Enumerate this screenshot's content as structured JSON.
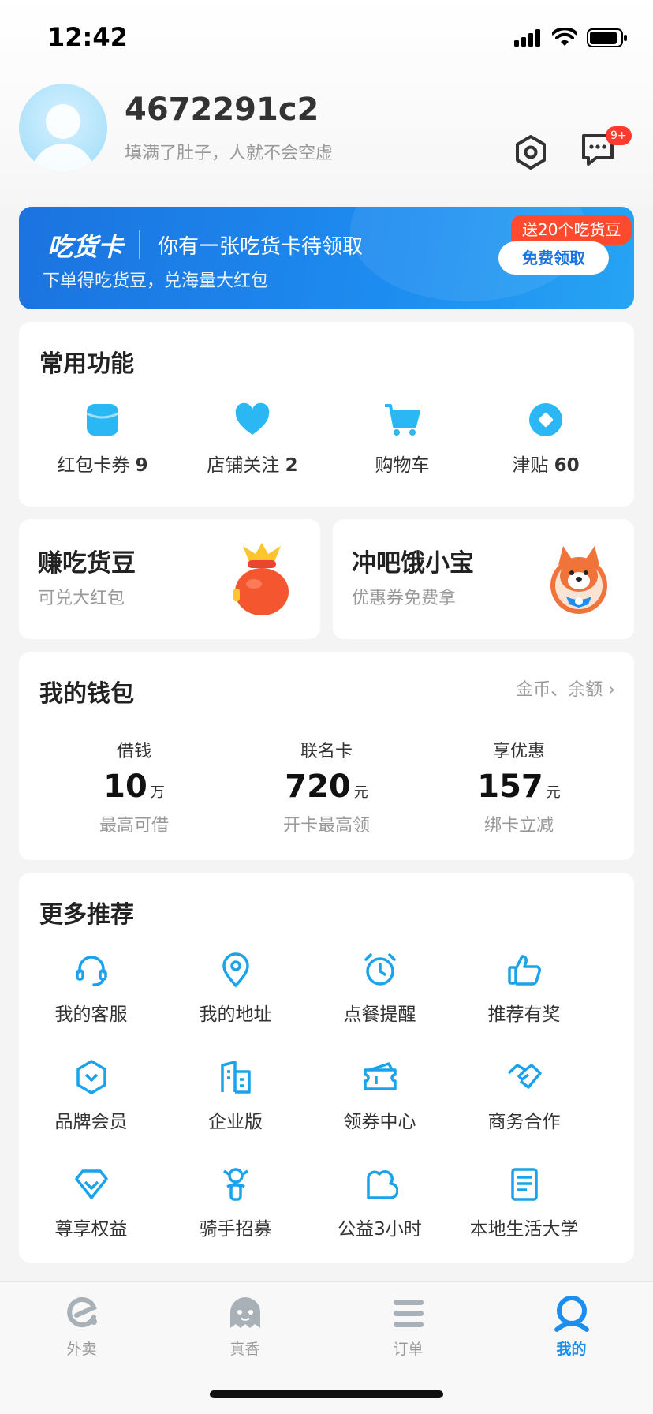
{
  "status_bar": {
    "time": "12:42"
  },
  "profile": {
    "username": "4672291c2",
    "motto": "填满了肚子，人就不会空虚",
    "message_badge": "9+"
  },
  "banner": {
    "logo": "吃货卡",
    "title": "你有一张吃货卡待领取",
    "subtitle": "下单得吃货豆，兑海量大红包",
    "tag": "送20个吃货豆",
    "button": "免费领取"
  },
  "common_features": {
    "title": "常用功能",
    "items": [
      {
        "label": "红包卡券",
        "count": "9",
        "icon": "coupon-icon"
      },
      {
        "label": "店铺关注",
        "count": "2",
        "icon": "heart-icon"
      },
      {
        "label": "购物车",
        "count": "",
        "icon": "cart-icon"
      },
      {
        "label": "津贴",
        "count": "60",
        "icon": "allowance-icon"
      }
    ]
  },
  "promos": [
    {
      "title": "赚吃货豆",
      "subtitle": "可兑大红包",
      "icon": "red-bag-icon"
    },
    {
      "title": "冲吧饿小宝",
      "subtitle": "优惠券免费拿",
      "icon": "shiba-mascot-icon"
    }
  ],
  "wallet": {
    "title": "我的钱包",
    "link": "金币、余额",
    "items": [
      {
        "header": "借钱",
        "value": "10",
        "unit": "万",
        "footer": "最高可借"
      },
      {
        "header": "联名卡",
        "value": "720",
        "unit": "元",
        "footer": "开卡最高领"
      },
      {
        "header": "享优惠",
        "value": "157",
        "unit": "元",
        "footer": "绑卡立减"
      }
    ]
  },
  "more": {
    "title": "更多推荐",
    "items": [
      {
        "label": "我的客服",
        "icon": "headset-icon"
      },
      {
        "label": "我的地址",
        "icon": "location-pin-icon"
      },
      {
        "label": "点餐提醒",
        "icon": "alarm-clock-icon"
      },
      {
        "label": "推荐有奖",
        "icon": "thumbs-up-icon"
      },
      {
        "label": "品牌会员",
        "icon": "brand-badge-icon"
      },
      {
        "label": "企业版",
        "icon": "building-icon"
      },
      {
        "label": "领券中心",
        "icon": "ticket-icon"
      },
      {
        "label": "商务合作",
        "icon": "handshake-icon"
      },
      {
        "label": "尊享权益",
        "icon": "diamond-icon"
      },
      {
        "label": "骑手招募",
        "icon": "rider-icon"
      },
      {
        "label": "公益3小时",
        "icon": "charity-icon"
      },
      {
        "label": "本地生活大学",
        "icon": "book-icon"
      }
    ]
  },
  "tabbar": {
    "items": [
      {
        "label": "外卖",
        "icon": "takeout-icon",
        "active": false
      },
      {
        "label": "真香",
        "icon": "ghost-icon",
        "active": false
      },
      {
        "label": "订单",
        "icon": "order-list-icon",
        "active": false
      },
      {
        "label": "我的",
        "icon": "profile-icon",
        "active": true
      }
    ]
  },
  "colors": {
    "accent": "#1a8ff0",
    "icon_blue": "#1aa3ea",
    "badge_red": "#ff3b30",
    "banner_blue": "#1b73e0"
  }
}
